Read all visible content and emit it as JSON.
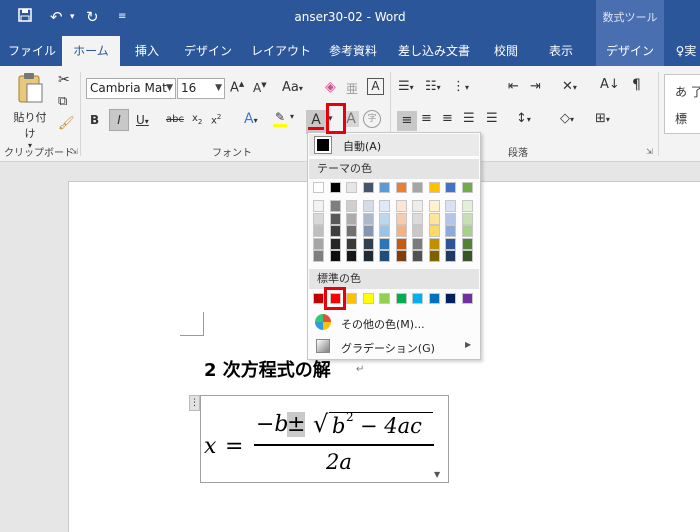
{
  "app": {
    "doc_title": "anser30-02 - Word",
    "context_tab_title": "数式ツール"
  },
  "tabs": [
    "ファイル",
    "ホーム",
    "挿入",
    "デザイン",
    "レイアウト",
    "参考資料",
    "差し込み文書",
    "校閲",
    "表示",
    "デザイン"
  ],
  "tell_me": "実",
  "ribbon": {
    "clipboard": {
      "paste_label": "貼り付け",
      "group_label": "クリップボード"
    },
    "font": {
      "name": "Cambria Mat",
      "size": "16",
      "group_label": "フォント"
    },
    "paragraph": {
      "group_label": "段落"
    },
    "styles": {
      "sample": "あ 了",
      "sample2": "標"
    }
  },
  "document": {
    "heading": "2 次方程式の解",
    "para_mark": "↵",
    "equation": {
      "x": "x",
      "eq": "=",
      "numerator_b": "−b",
      "pm": "±",
      "b2": "b",
      "sq": "2",
      "rest": "− 4ac",
      "denominator": "2a"
    }
  },
  "font_color_menu": {
    "auto_label": "自動(A)",
    "theme_header": "テーマの色",
    "standard_header": "標準の色",
    "more_colors": "その他の色(M)...",
    "gradient": "グラデーション(G)",
    "theme_colors": [
      "#ffffff",
      "#000000",
      "#e7e6e6",
      "#44546a",
      "#5b9bd5",
      "#ed7d31",
      "#a5a5a5",
      "#ffc000",
      "#4472c4",
      "#70ad47"
    ],
    "theme_shades": [
      [
        "#f2f2f2",
        "#7f7f7f",
        "#d0cece",
        "#d6dce4",
        "#deebf6",
        "#fbe5d5",
        "#ededed",
        "#fff2cc",
        "#d9e2f3",
        "#e2efd9"
      ],
      [
        "#d8d8d8",
        "#595959",
        "#aeabab",
        "#adb9ca",
        "#bdd7ee",
        "#f7cbac",
        "#dbdbdb",
        "#fee599",
        "#b4c6e7",
        "#c5e0b3"
      ],
      [
        "#bfbfbf",
        "#3f3f3f",
        "#757070",
        "#8496b0",
        "#9cc3e5",
        "#f4b183",
        "#c9c9c9",
        "#ffd965",
        "#8eaadb",
        "#a8d08d"
      ],
      [
        "#a5a5a5",
        "#262626",
        "#3a3838",
        "#323f4f",
        "#2e75b5",
        "#c55a11",
        "#7b7b7b",
        "#bf9000",
        "#2f5496",
        "#538135"
      ],
      [
        "#7f7f7f",
        "#0c0c0c",
        "#171616",
        "#222a35",
        "#1e4e79",
        "#833c0b",
        "#525252",
        "#7f6000",
        "#1f3864",
        "#375623"
      ]
    ],
    "standard_colors": [
      "#c00000",
      "#ff0000",
      "#ffc000",
      "#ffff00",
      "#92d050",
      "#00b050",
      "#00b0f0",
      "#0070c0",
      "#002060",
      "#7030a0"
    ],
    "highlight_color": "#e8000b"
  }
}
